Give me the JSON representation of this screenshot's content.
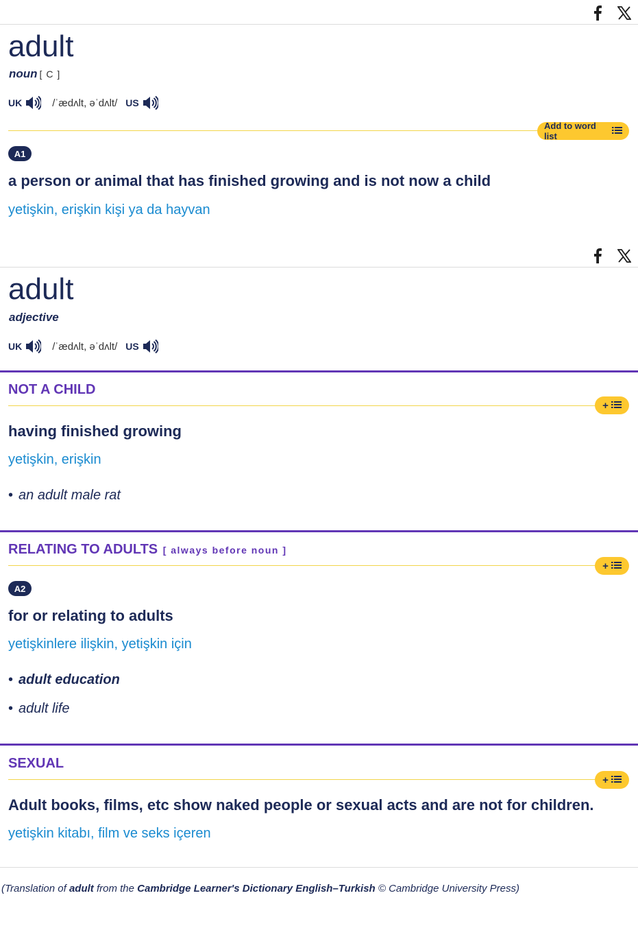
{
  "entries": [
    {
      "headword": "adult",
      "pos": "noun",
      "grammar": "[ C ]",
      "uk_label": "UK",
      "ipa": "/ˈædʌlt, əˈdʌlt/",
      "us_label": "US",
      "word_list_label": "Add to word list",
      "level": "A1",
      "definition": "a person or animal that has finished growing and is not now a child",
      "translation": "yetişkin, erişkin kişi ya da hayvan"
    },
    {
      "headword": "adult",
      "pos": "adjective",
      "uk_label": "UK",
      "ipa": "/ˈædʌlt, əˈdʌlt/",
      "us_label": "US",
      "senses": [
        {
          "guideword": "NOT A CHILD",
          "definition": "having finished growing",
          "translation": "yetişkin, erişkin",
          "examples": [
            "an adult male rat"
          ]
        },
        {
          "guideword": "RELATING TO ADULTS",
          "grammar": "[ always before noun ]",
          "level": "A2",
          "definition": "for or relating to adults",
          "translation": "yetişkinlere ilişkin, yetişkin için",
          "examples": [
            "adult education",
            "adult life"
          ]
        },
        {
          "guideword": "SEXUAL",
          "definition": "Adult books, films, etc show naked people or sexual acts and are not for children.",
          "translation": "yetişkin kitabı, film ve seks içeren"
        }
      ]
    }
  ],
  "credit": {
    "prefix": "(Translation of ",
    "word": "adult",
    "middle": " from the ",
    "dictionary": "Cambridge Learner's Dictionary English–Turkish",
    "suffix": " © Cambridge University Press)"
  },
  "icons": {
    "share": [
      "facebook-icon",
      "x-icon"
    ],
    "audio": "speaker-icon",
    "word_list": "plus-list-icon"
  },
  "colors": {
    "navy": "#1d2a57",
    "translation_blue": "#1a8bd0",
    "guideword_purple": "#6136b5",
    "wordlist_yellow": "#fdc82f"
  }
}
